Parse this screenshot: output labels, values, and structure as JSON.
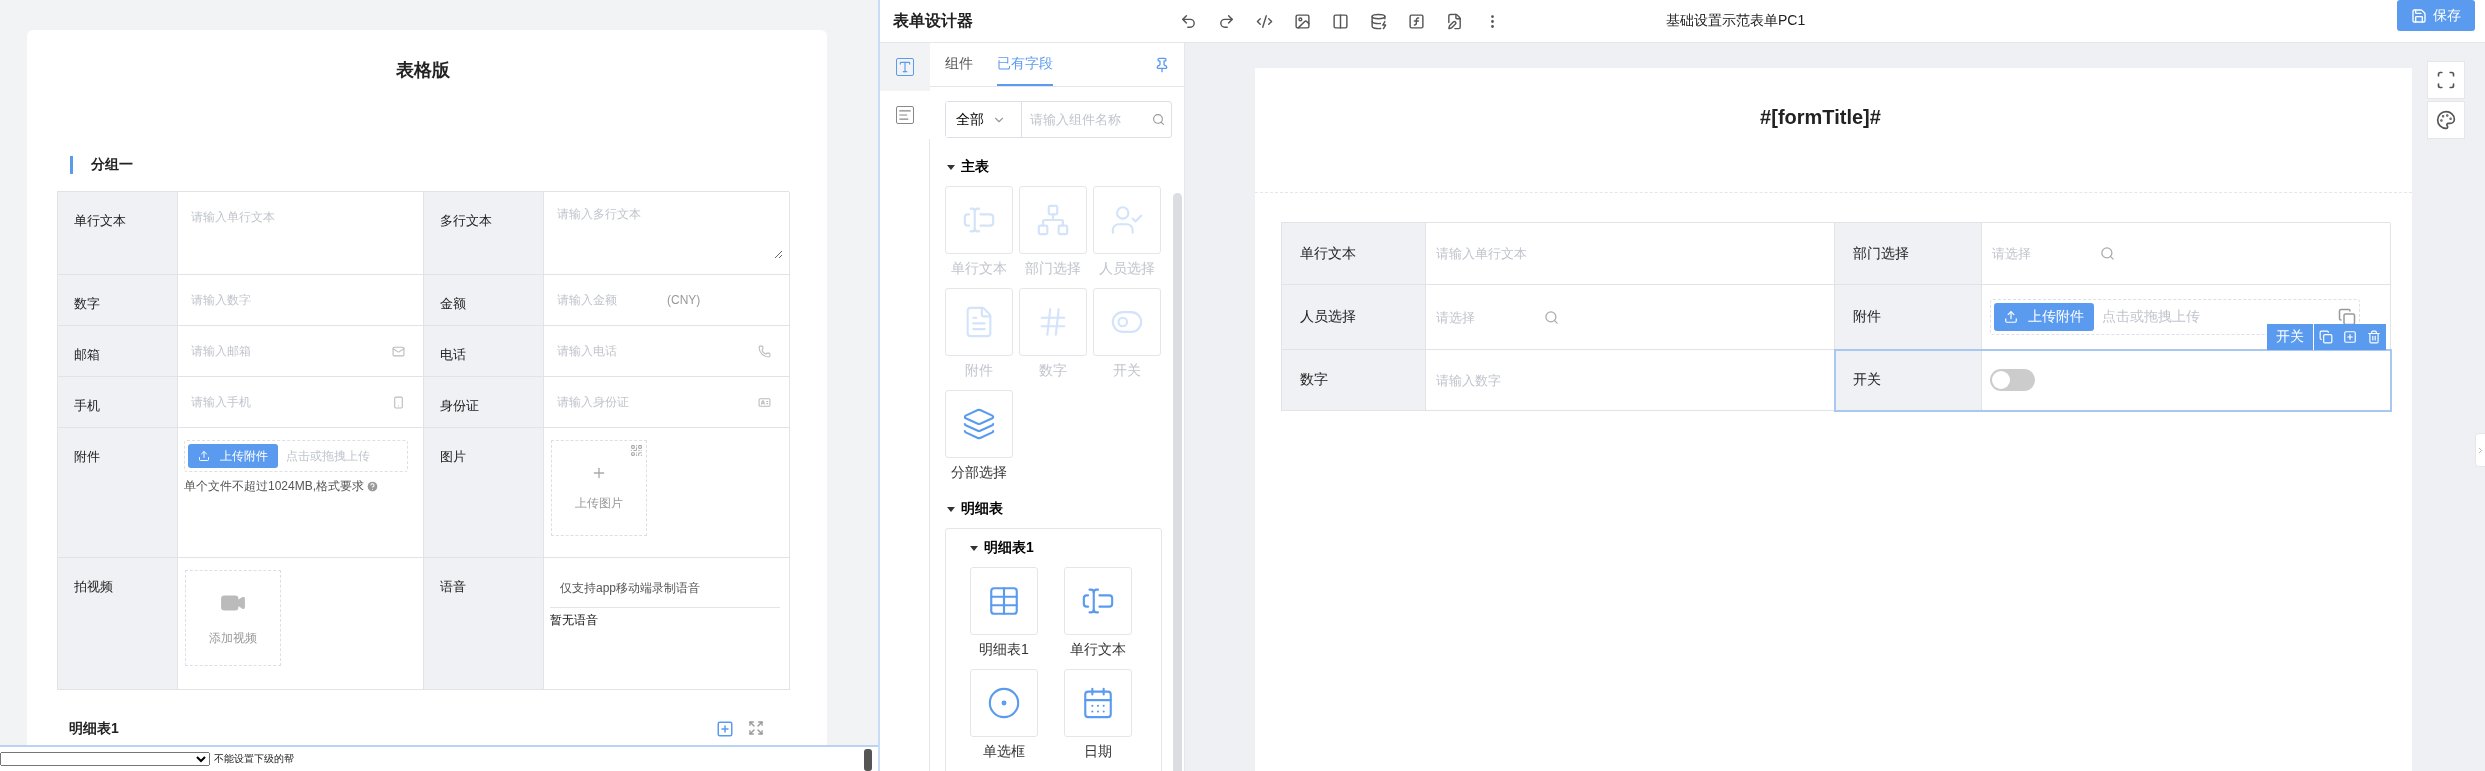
{
  "preview": {
    "title": "表格版",
    "group": "分组一",
    "rows": [
      [
        {
          "label": "单行文本",
          "field": {
            "kind": "text",
            "placeholder": "请输入单行文本"
          }
        },
        {
          "label": "多行文本",
          "field": {
            "kind": "textarea",
            "placeholder": "请输入多行文本"
          }
        }
      ],
      [
        {
          "label": "数字",
          "field": {
            "kind": "text",
            "placeholder": "请输入数字"
          }
        },
        {
          "label": "金额",
          "field": {
            "kind": "amount",
            "placeholder": "请输入金额",
            "unit": "(CNY)"
          }
        }
      ],
      [
        {
          "label": "邮箱",
          "field": {
            "kind": "email",
            "placeholder": "请输入邮箱"
          }
        },
        {
          "label": "电话",
          "field": {
            "kind": "phone",
            "placeholder": "请输入电话"
          }
        }
      ],
      [
        {
          "label": "手机",
          "field": {
            "kind": "mobile",
            "placeholder": "请输入手机"
          }
        },
        {
          "label": "身份证",
          "field": {
            "kind": "idcard",
            "placeholder": "请输入身份证"
          }
        }
      ],
      [
        {
          "label": "附件",
          "field": {
            "kind": "upload",
            "button": "上传附件",
            "hint": "点击或拖拽上传",
            "note": "单个文件不超过1024MB,格式要求"
          }
        },
        {
          "label": "图片",
          "field": {
            "kind": "image",
            "label": "上传图片"
          }
        }
      ],
      [
        {
          "label": "拍视频",
          "field": {
            "kind": "video",
            "label": "添加视频"
          }
        },
        {
          "label": "语音",
          "field": {
            "kind": "voice",
            "note": "仅支持app移动端录制语音",
            "empty": "暂无语音"
          }
        }
      ]
    ],
    "detail_table": {
      "title": "明细表1"
    }
  },
  "bottom_bar": {
    "text": "不能设置下级的帮"
  },
  "designer": {
    "title": "表单设计器",
    "form_name": "基础设置示范表单PC1",
    "save": "保存",
    "rail": [
      {
        "kind": "field",
        "selected": true
      },
      {
        "kind": "style",
        "selected": false
      }
    ],
    "tabs": [
      {
        "label": "组件",
        "selected": false
      },
      {
        "label": "已有字段",
        "selected": true
      }
    ],
    "filter": {
      "value": "全部",
      "placeholder": "请输入组件名称"
    },
    "sections": [
      {
        "title": "主表",
        "expanded": true,
        "items": [
          {
            "label": "单行文本",
            "kind": "text",
            "disabled": true
          },
          {
            "label": "部门选择",
            "kind": "dept",
            "disabled": true
          },
          {
            "label": "人员选择",
            "kind": "user",
            "disabled": true
          },
          {
            "label": "附件",
            "kind": "file",
            "disabled": true
          },
          {
            "label": "数字",
            "kind": "number",
            "disabled": true
          },
          {
            "label": "开关",
            "kind": "switch",
            "disabled": true
          },
          {
            "label": "分部选择",
            "kind": "branch",
            "disabled": false
          }
        ]
      },
      {
        "title": "明细表",
        "expanded": true,
        "children": [
          {
            "title": "明细表1",
            "expanded": true,
            "items": [
              {
                "label": "明细表1",
                "kind": "table",
                "disabled": false
              },
              {
                "label": "单行文本",
                "kind": "text",
                "disabled": false
              },
              {
                "label": "单选框",
                "kind": "radio",
                "disabled": false
              },
              {
                "label": "日期",
                "kind": "date",
                "disabled": false
              }
            ]
          }
        ]
      }
    ],
    "form": {
      "title": "#[formTitle]#",
      "action_label": "开关",
      "rows": [
        [
          {
            "label": "单行文本",
            "selected": false,
            "field": {
              "kind": "text",
              "placeholder": "请输入单行文本"
            }
          },
          {
            "label": "部门选择",
            "selected": false,
            "field": {
              "kind": "select",
              "placeholder": "请选择"
            }
          }
        ],
        [
          {
            "label": "人员选择",
            "selected": false,
            "field": {
              "kind": "select",
              "placeholder": "请选择"
            }
          },
          {
            "label": "附件",
            "selected": false,
            "field": {
              "kind": "upload",
              "button": "上传附件",
              "hint": "点击或拖拽上传"
            }
          }
        ],
        [
          {
            "label": "数字",
            "selected": false,
            "field": {
              "kind": "text",
              "placeholder": "请输入数字"
            }
          },
          {
            "label": "开关",
            "selected": true,
            "field": {
              "kind": "switch",
              "on": false
            }
          }
        ]
      ]
    }
  }
}
